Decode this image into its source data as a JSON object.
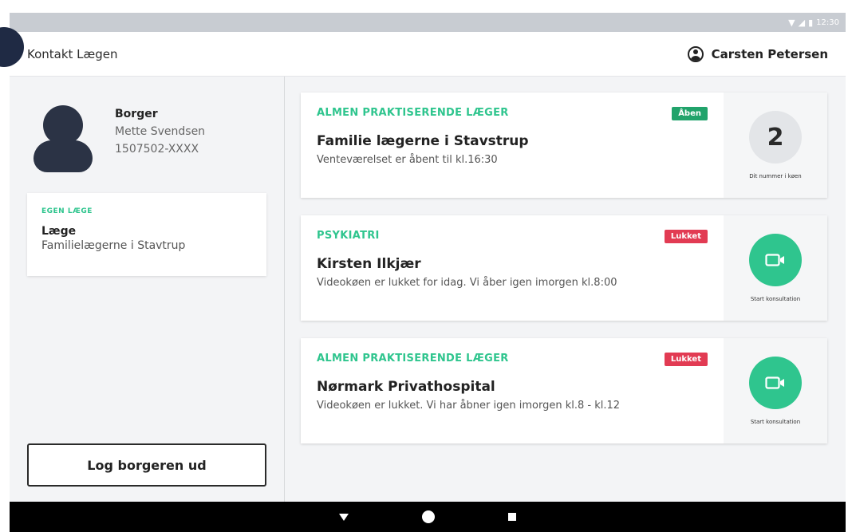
{
  "status_bar": {
    "time": "12:30",
    "icons": [
      "wifi-icon",
      "signal-icon",
      "battery-icon"
    ]
  },
  "header": {
    "title": "Kontakt Lægen",
    "user_name": "Carsten Petersen"
  },
  "citizen": {
    "role": "Borger",
    "name": "Mette Svendsen",
    "id": "1507502-XXXX"
  },
  "own_doctor": {
    "kicker": "EGEN LÆGE",
    "title": "Læge",
    "clinic": "Familielægerne i Stavtrup"
  },
  "logout_label": "Log borgeren ud",
  "cards": [
    {
      "category": "ALMEN PRAKTISERENDE LÆGER",
      "name": "Familie lægerne i Stavstrup",
      "description": "Venteværelset er åbent til kl.16:30",
      "status": "Åben",
      "queue_number": "2",
      "action_label": "Dit nummer i køen"
    },
    {
      "category": "PSYKIATRI",
      "name": "Kirsten Ilkjær",
      "description": "Videokøen er lukket for idag. Vi åber igen imorgen kl.8:00",
      "status": "Lukket",
      "action_label": "Start konsultation"
    },
    {
      "category": "ALMEN PRAKTISERENDE LÆGER",
      "name": "Nørmark Privathospital",
      "description": "Videokøen er lukket. Vi har åbner igen imorgen kl.8 - kl.12",
      "status": "Lukket",
      "action_label": "Start konsultation"
    }
  ],
  "colors": {
    "accent_green": "#2fc58e",
    "open_badge": "#21a36b",
    "closed_badge": "#e23b53",
    "avatar": "#2b3345"
  }
}
